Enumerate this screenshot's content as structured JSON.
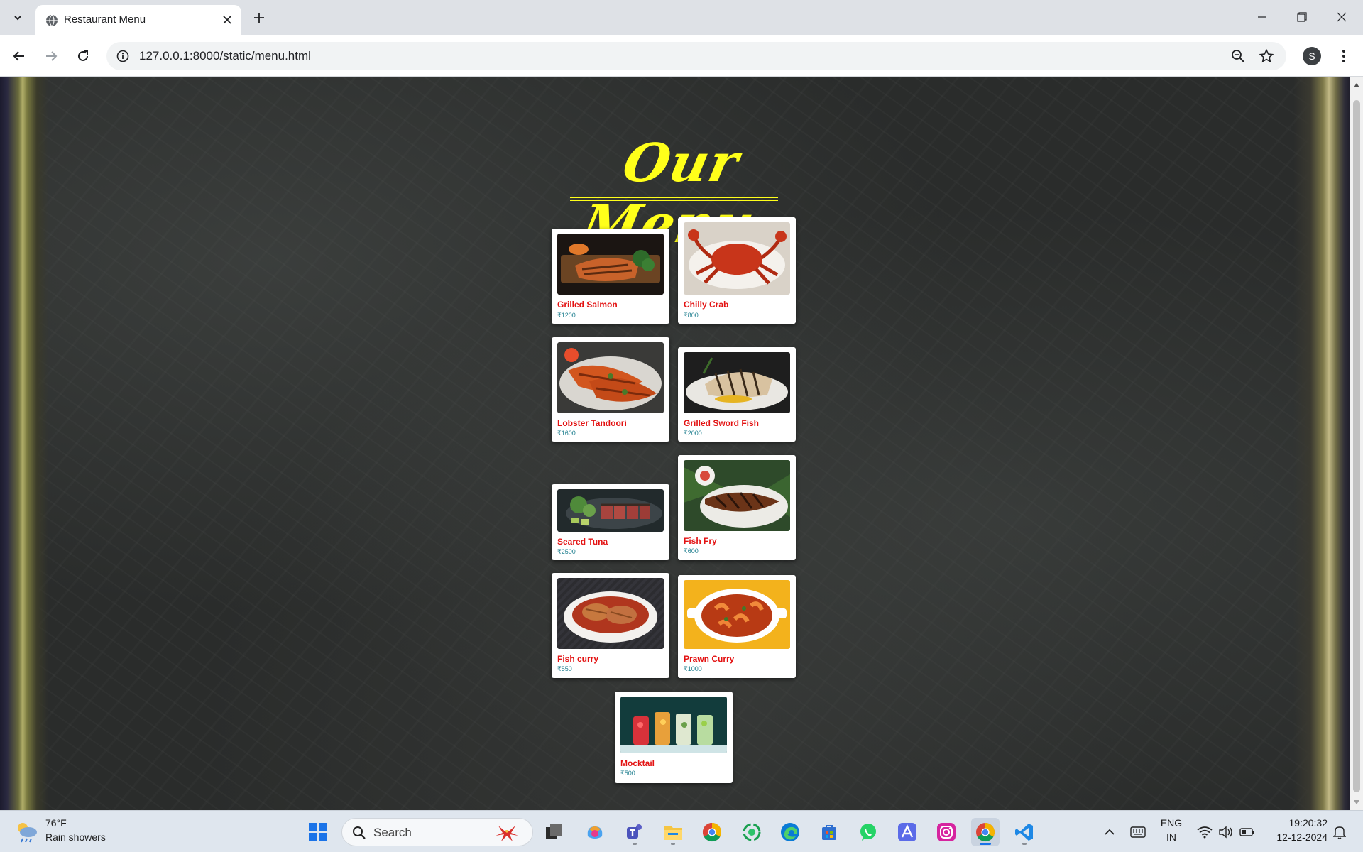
{
  "browser": {
    "tab_title": "Restaurant Menu",
    "url": "127.0.0.1:8000/static/menu.html",
    "profile_initial": "S"
  },
  "page": {
    "heading": "Our Menu",
    "items": [
      {
        "name": "Grilled Salmon",
        "price": "₹1200",
        "image": "grilled-salmon-photo"
      },
      {
        "name": "Chilly Crab",
        "price": "₹800",
        "image": "chilly-crab-photo"
      },
      {
        "name": "Lobster Tandoori",
        "price": "₹1600",
        "image": "lobster-tandoori-photo"
      },
      {
        "name": "Grilled Sword Fish",
        "price": "₹2000",
        "image": "grilled-sword-fish-photo"
      },
      {
        "name": "Seared Tuna",
        "price": "₹2500",
        "image": "seared-tuna-photo"
      },
      {
        "name": "Fish Fry",
        "price": "₹600",
        "image": "fish-fry-photo"
      },
      {
        "name": "Fish curry",
        "price": "₹550",
        "image": "fish-curry-photo"
      },
      {
        "name": "Prawn Curry",
        "price": "₹1000",
        "image": "prawn-curry-photo"
      },
      {
        "name": "Mocktail",
        "price": "₹500",
        "image": "mocktail-photo"
      }
    ]
  },
  "taskbar": {
    "weather_temp": "76°F",
    "weather_desc": "Rain showers",
    "search_placeholder": "Search",
    "lang_line1": "ENG",
    "lang_line2": "IN",
    "time": "19:20:32",
    "date": "12-12-2024"
  },
  "colors": {
    "heading": "#ffff1a",
    "item_name": "#e31212",
    "item_price": "#1f7f8f",
    "card_bg": "#ffffff"
  }
}
